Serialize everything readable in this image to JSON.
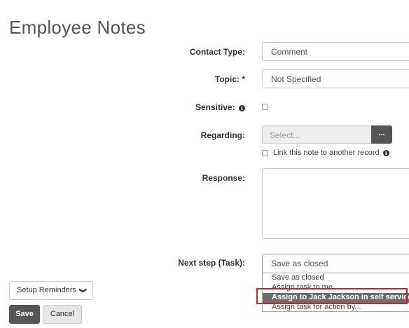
{
  "page": {
    "title": "Employee Notes"
  },
  "form": {
    "contact_type": {
      "label": "Contact Type:",
      "value": "Comment"
    },
    "topic": {
      "label": "Topic: *",
      "value": "Not Specified"
    },
    "sensitive": {
      "label": "Sensitive:",
      "checked": false,
      "icon": "info-icon"
    },
    "regarding": {
      "label": "Regarding:",
      "placeholder": "Select...",
      "browse_label": "..."
    },
    "link_note": {
      "label": "Link this note to another record",
      "checked": false,
      "icon": "info-icon"
    },
    "response": {
      "label": "Response:",
      "value": ""
    },
    "next_step": {
      "label": "Next step (Task):",
      "value": "Save as closed",
      "options": [
        "Save as closed",
        "Assign task to me",
        "Assign to Jack Jackson in self service",
        "Assign task for action by..."
      ],
      "highlighted_index": 2
    }
  },
  "actions": {
    "setup_reminders": "Setup Reminders",
    "save": "Save",
    "cancel": "Cancel"
  },
  "colors": {
    "highlight_outline": "#d0202a",
    "primary_button": "#555555"
  }
}
